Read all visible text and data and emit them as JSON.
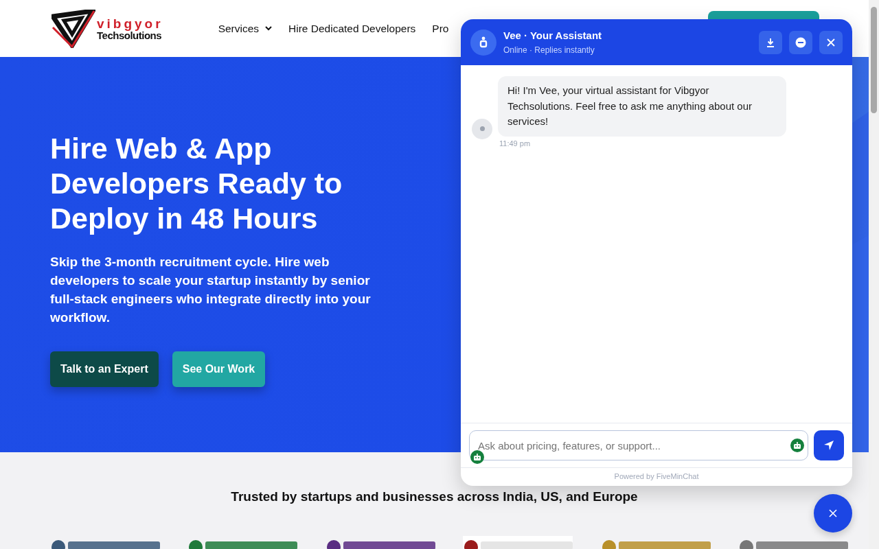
{
  "header": {
    "logo": {
      "brand": "vibgyor",
      "tagline": "Techsolutions"
    },
    "nav": [
      {
        "label": "Services",
        "has_caret": true
      },
      {
        "label": "Hire Dedicated Developers",
        "has_caret": false
      },
      {
        "label": "Pro",
        "has_caret": false
      }
    ]
  },
  "hero": {
    "title": "Hire Web & App Developers Ready to Deploy in 48 Hours",
    "subtitle": "Skip the 3-month recruitment cycle. Hire web developers to scale your startup instantly by senior full-stack engineers who integrate directly into your workflow.",
    "buttons": [
      {
        "label": "Talk to an Expert",
        "kind": "dark"
      },
      {
        "label": "See Our Work",
        "kind": "teal"
      }
    ]
  },
  "trusted": {
    "heading": "Trusted by startups and businesses across India, US, and Europe"
  },
  "chat": {
    "title": "Vee · Your Assistant",
    "status": "Online · Replies instantly",
    "messages": [
      {
        "text": "Hi! I'm Vee, your virtual assistant for Vibgyor Techsolutions. Feel free to ask me anything about our services!",
        "time": "11:49 pm"
      }
    ],
    "input": {
      "placeholder": "Ask about pricing, features, or support..."
    },
    "footer": "Powered by FiveMinChat"
  }
}
